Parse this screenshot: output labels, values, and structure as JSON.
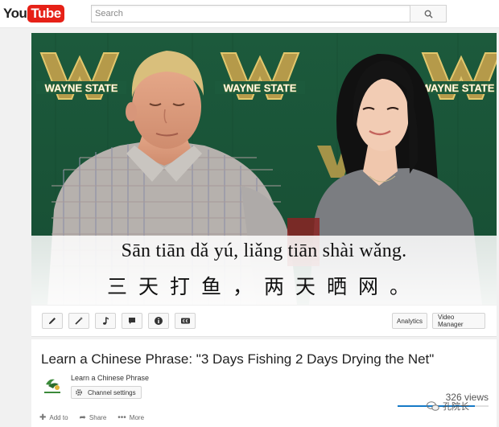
{
  "header": {
    "logo_you": "You",
    "logo_tube": "Tube",
    "search_placeholder": "Search"
  },
  "video": {
    "backdrop_text": "WAYNE STATE",
    "subtitle_pinyin": "Sān tiān dǎ yú, liǎng tiān shài wǎng.",
    "subtitle_hanzi": "三天打鱼，两天晒网。"
  },
  "toolbar": {
    "tools": [
      "pencil-icon",
      "magic-wand-icon",
      "music-note-icon",
      "annotation-icon",
      "info-icon",
      "captions-icon"
    ],
    "analytics_label": "Analytics",
    "video_manager_label": "Video Manager"
  },
  "info": {
    "title": "Learn a Chinese Phrase: \"3 Days Fishing 2 Days Drying the Net\"",
    "channel_name": "Learn a Chinese Phrase",
    "channel_settings_label": "Channel settings",
    "views": "326 views",
    "view_ratio": 0.85,
    "actions": {
      "add_to": "Add to",
      "share": "Share",
      "more": "More"
    }
  },
  "watermark": "孔院长"
}
